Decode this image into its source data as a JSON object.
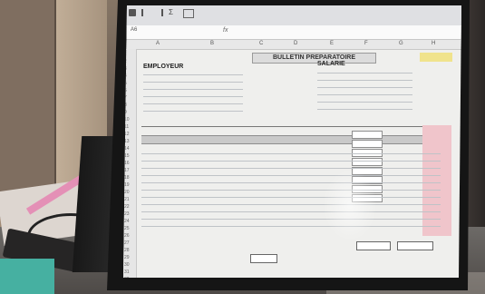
{
  "spreadsheet": {
    "name_box": "A6",
    "formula_bar_icon": "fx",
    "title": "BULLETIN PREPARATOIRE",
    "employer_label": "EMPLOYEUR",
    "employee_label": "SALARIE",
    "column_letters": [
      "A",
      "B",
      "C",
      "D",
      "E",
      "F",
      "G",
      "H"
    ],
    "row_numbers": [
      "1",
      "2",
      "3",
      "4",
      "5",
      "6",
      "7",
      "8",
      "9",
      "10",
      "11",
      "12",
      "13",
      "14",
      "15",
      "16",
      "17",
      "18",
      "19",
      "20",
      "21",
      "22",
      "23",
      "24",
      "25",
      "26",
      "27",
      "28",
      "29",
      "30",
      "31",
      "32"
    ]
  }
}
